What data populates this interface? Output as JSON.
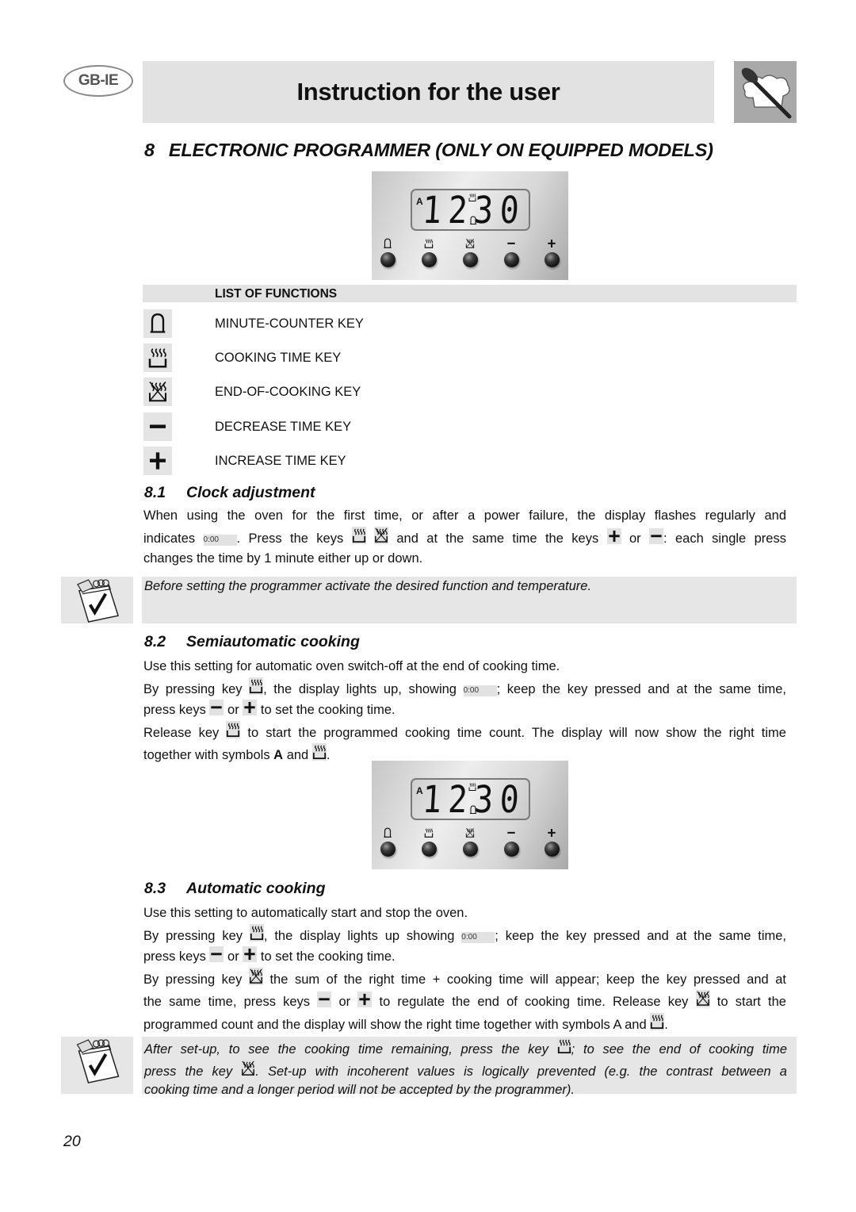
{
  "header": {
    "language_badge": "GB-IE",
    "title": "Instruction for the user",
    "logo_icon": "chef-hat-spoon-icon"
  },
  "section": {
    "number": "8",
    "title": "ELECTRONIC PROGRAMMER (ONLY ON EQUIPPED MODELS)"
  },
  "panel": {
    "display_prefix": "A",
    "display_time": "12:30",
    "display_digits": "1230",
    "keys": [
      {
        "name": "minute-counter",
        "icon": "bell-icon"
      },
      {
        "name": "cooking-time",
        "icon": "cooking-pot-icon"
      },
      {
        "name": "end-of-cooking",
        "icon": "end-cooking-icon"
      },
      {
        "name": "decrease",
        "icon": "minus-icon"
      },
      {
        "name": "increase",
        "icon": "plus-icon"
      }
    ]
  },
  "functions": {
    "header": "LIST OF FUNCTIONS",
    "items": [
      {
        "icon": "bell-icon",
        "label": "MINUTE-COUNTER KEY"
      },
      {
        "icon": "cooking-pot-icon",
        "label": "COOKING TIME KEY"
      },
      {
        "icon": "end-cooking-icon",
        "label": "END-OF-COOKING KEY"
      },
      {
        "icon": "minus-icon",
        "label": "DECREASE TIME KEY"
      },
      {
        "icon": "plus-icon",
        "label": "INCREASE TIME KEY"
      }
    ]
  },
  "clock": {
    "number": "8.1",
    "title": "Clock adjustment",
    "l1": "When using the oven for the first time, or after a power failure, the display flashes regularly and",
    "l2a": "indicates",
    "display": "0:00",
    "l2b": ". Press the keys",
    "l2c": "and at the same time the keys",
    "l2d": "or",
    "l2e": ": each single press",
    "l3": "changes the time by 1 minute either up or down."
  },
  "note1": {
    "icon": "notepad-check-icon",
    "text": "Before setting the programmer activate the desired function and temperature."
  },
  "semi": {
    "number": "8.2",
    "title": "Semiautomatic cooking",
    "l1": "Use this setting for automatic oven switch-off at the end of cooking time.",
    "l2a": "By pressing key",
    "l2b": ", the display lights up, showing",
    "display": "0:00",
    "l2c": "; keep the key pressed and at the same time,",
    "l3a": "press keys",
    "l3b": "or",
    "l3c": "to set the cooking time.",
    "l4a": "Release key",
    "l4b": "to start the programmed cooking time count. The display will now show the right time",
    "l5a": "together with symbols",
    "l5b": "A",
    "l5c": "and",
    "l5d": "."
  },
  "auto": {
    "number": "8.3",
    "title": "Automatic cooking",
    "l1": "Use this setting to automatically start and stop the oven.",
    "l2a": "By pressing key",
    "l2b": ", the display lights up showing",
    "display": "0:00",
    "l2c": "; keep the key pressed and at the same time,",
    "l3a": "press keys",
    "l3b": "or",
    "l3c": "to set the cooking time.",
    "l4a": "By pressing key",
    "l4b": "the sum of the right time + cooking time will appear; keep the key pressed and at",
    "l5a": "the same time, press keys",
    "l5b": "or",
    "l5c": "to regulate the end of cooking time. Release key",
    "l5d": "to start the",
    "l6a": "programmed count and the display will show the right time together with symbols A and",
    "l6b": "."
  },
  "note2": {
    "icon": "notepad-check-icon",
    "l1a": "After set-up, to see the cooking time remaining, press the key",
    "l1b": "; to see the end of cooking time",
    "l2a": "press the key",
    "l2b": ". Set-up with incoherent values is logically prevented (e.g. the contrast between a",
    "l3": "cooking time and a longer period will not be accepted by the programmer)."
  },
  "page_number": "20"
}
